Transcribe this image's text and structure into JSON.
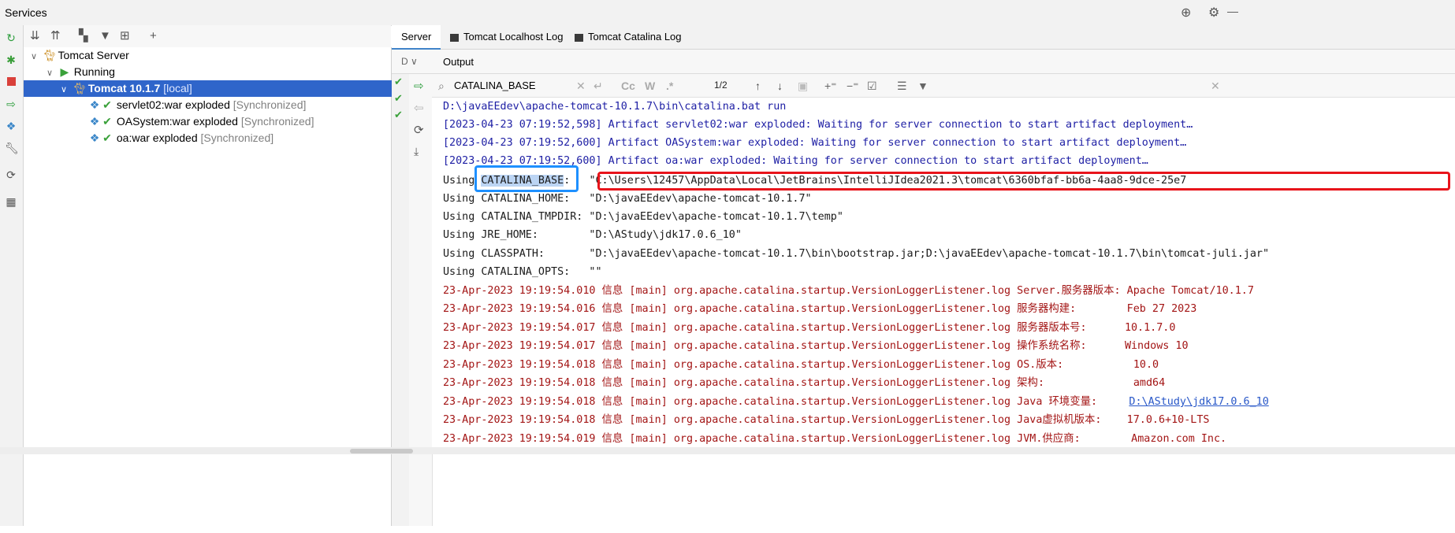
{
  "window": {
    "title": "Services"
  },
  "tree": {
    "items": [
      {
        "label": "Tomcat Server",
        "suffix": ""
      },
      {
        "label": "Running",
        "suffix": ""
      },
      {
        "label": "Tomcat 10.1.7",
        "suffix": "[local]"
      },
      {
        "label": "servlet02:war exploded",
        "suffix": "[Synchronized]"
      },
      {
        "label": "OASystem:war exploded",
        "suffix": "[Synchronized]"
      },
      {
        "label": "oa:war exploded",
        "suffix": "[Synchronized]"
      }
    ]
  },
  "tabs": [
    {
      "label": "Server"
    },
    {
      "label": "Tomcat Localhost Log"
    },
    {
      "label": "Tomcat Catalina Log"
    }
  ],
  "output": {
    "label": "Output",
    "dropdown_label": "D"
  },
  "search": {
    "query": "CATALINA_BASE",
    "match_count": "1/2",
    "case_label": "Cc",
    "word_label": "W",
    "regex_label": ".*"
  },
  "console": {
    "lines": [
      {
        "text": "D:\\javaEEdev\\apache-tomcat-10.1.7\\bin\\catalina.bat run",
        "style": "blue"
      },
      {
        "text": "[2023-04-23 07:19:52,598] Artifact servlet02:war exploded: Waiting for server connection to start artifact deployment…",
        "style": "blue"
      },
      {
        "text": "[2023-04-23 07:19:52,600] Artifact OASystem:war exploded: Waiting for server connection to start artifact deployment…",
        "style": "blue"
      },
      {
        "text": "[2023-04-23 07:19:52,600] Artifact oa:war exploded: Waiting for server connection to start artifact deployment…",
        "style": "blue"
      },
      {
        "text": "",
        "style": "dark"
      },
      {
        "text": "Using CATALINA_HOME:   \"D:\\javaEEdev\\apache-tomcat-10.1.7\"",
        "style": "dark"
      },
      {
        "text": "Using CATALINA_TMPDIR: \"D:\\javaEEdev\\apache-tomcat-10.1.7\\temp\"",
        "style": "dark"
      },
      {
        "text": "Using JRE_HOME:        \"D:\\AStudy\\jdk17.0.6_10\"",
        "style": "dark"
      },
      {
        "text": "Using CLASSPATH:       \"D:\\javaEEdev\\apache-tomcat-10.1.7\\bin\\bootstrap.jar;D:\\javaEEdev\\apache-tomcat-10.1.7\\bin\\tomcat-juli.jar\"",
        "style": "dark"
      },
      {
        "text": "Using CATALINA_OPTS:   \"\"",
        "style": "dark"
      },
      {
        "text": "23-Apr-2023 19:19:54.010 信息 [main] org.apache.catalina.startup.VersionLoggerListener.log Server.服务器版本: Apache Tomcat/10.1.7",
        "style": "red"
      },
      {
        "text": "23-Apr-2023 19:19:54.016 信息 [main] org.apache.catalina.startup.VersionLoggerListener.log 服务器构建:        Feb 27 2023",
        "style": "red"
      },
      {
        "text": "23-Apr-2023 19:19:54.017 信息 [main] org.apache.catalina.startup.VersionLoggerListener.log 服务器版本号:      10.1.7.0",
        "style": "red"
      },
      {
        "text": "23-Apr-2023 19:19:54.017 信息 [main] org.apache.catalina.startup.VersionLoggerListener.log 操作系统名称:      Windows 10",
        "style": "red"
      },
      {
        "text": "23-Apr-2023 19:19:54.018 信息 [main] org.apache.catalina.startup.VersionLoggerListener.log OS.版本:           10.0",
        "style": "red"
      },
      {
        "text": "23-Apr-2023 19:19:54.018 信息 [main] org.apache.catalina.startup.VersionLoggerListener.log 架构:              amd64",
        "style": "red"
      },
      {
        "text": "23-Apr-2023 19:19:54.018 信息 [main] org.apache.catalina.startup.VersionLoggerListener.log Java 环境变量:     ",
        "style": "red",
        "link": "D:\\AStudy\\jdk17.0.6_10"
      },
      {
        "text": "23-Apr-2023 19:19:54.018 信息 [main] org.apache.catalina.startup.VersionLoggerListener.log Java虚拟机版本:    17.0.6+10-LTS",
        "style": "red"
      },
      {
        "text": "23-Apr-2023 19:19:54.019 信息 [main] org.apache.catalina.startup.VersionLoggerListener.log JVM.供应商:        Amazon.com Inc.",
        "style": "red"
      }
    ],
    "base_line": {
      "prefix": "Using ",
      "highlight": "CATALINA_BASE",
      "colon": ":   ",
      "value": "\"C:\\Users\\12457\\AppData\\Local\\JetBrains\\IntelliJIdea2021.3\\tomcat\\6360bfaf-bb6a-4aa8-9dce-25e7"
    }
  },
  "annotations": {
    "blue_box_color": "#1e90ff",
    "red_box_color": "#e8141b"
  }
}
